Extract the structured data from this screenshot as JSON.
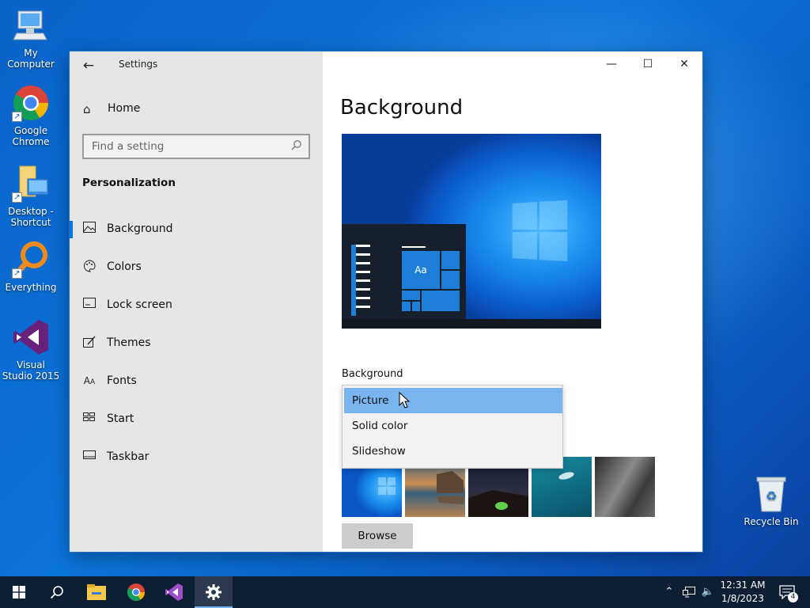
{
  "desktop": {
    "icons": [
      {
        "label": "My Computer"
      },
      {
        "label": "Google Chrome"
      },
      {
        "label": "Desktop - Shortcut"
      },
      {
        "label": "Everything"
      },
      {
        "label": "Visual Studio 2015"
      }
    ],
    "recycle_bin": {
      "label": "Recycle Bin"
    }
  },
  "window": {
    "title": "Settings",
    "back_icon": "arrow-left-icon",
    "controls": {
      "minimize": "minimize-icon",
      "maximize": "maximize-icon",
      "close": "close-icon"
    }
  },
  "nav": {
    "home_label": "Home",
    "search_placeholder": "Find a setting",
    "section_heading": "Personalization",
    "items": [
      {
        "label": "Background",
        "icon": "picture-icon",
        "selected": true
      },
      {
        "label": "Colors",
        "icon": "palette-icon",
        "selected": false
      },
      {
        "label": "Lock screen",
        "icon": "lock-screen-icon",
        "selected": false
      },
      {
        "label": "Themes",
        "icon": "themes-icon",
        "selected": false
      },
      {
        "label": "Fonts",
        "icon": "fonts-icon",
        "selected": false
      },
      {
        "label": "Start",
        "icon": "start-icon",
        "selected": false
      },
      {
        "label": "Taskbar",
        "icon": "taskbar-icon",
        "selected": false
      }
    ]
  },
  "content": {
    "title": "Background",
    "preview_tile_text": "Aa",
    "background_label": "Background",
    "dropdown_options": [
      {
        "label": "Picture",
        "selected": true
      },
      {
        "label": "Solid color",
        "selected": false
      },
      {
        "label": "Slideshow",
        "selected": false
      }
    ],
    "browse_label": "Browse"
  },
  "taskbar": {
    "clock": {
      "time": "12:31 AM",
      "date": "1/8/2023"
    },
    "notification_count": "4"
  },
  "colors": {
    "accent": "#0078d7",
    "nav_bg": "#e6e6e6",
    "dropdown_selected": "#79b4ee",
    "taskbar_bg": "#0e1e33"
  }
}
